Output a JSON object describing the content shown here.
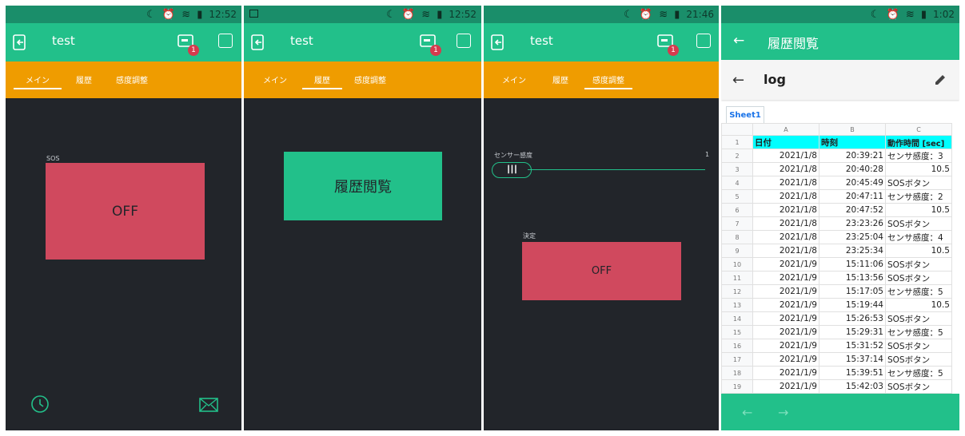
{
  "colors": {
    "primary": "#22c08a",
    "accent": "#ef9c00",
    "danger": "#d0495e",
    "background": "#22252a",
    "header_fill": "#00ffff"
  },
  "app": {
    "title": "test",
    "badge_count": "1",
    "tabs": [
      "メイン",
      "履歴",
      "感度調整"
    ]
  },
  "screens": [
    {
      "status_time": "12:52",
      "active_tab": 0
    },
    {
      "status_time": "12:52",
      "active_tab": 1
    },
    {
      "status_time": "21:46",
      "active_tab": 2
    },
    {
      "status_time": "1:02"
    }
  ],
  "main": {
    "sos_label": "SOS",
    "sos_button": "OFF",
    "icons": [
      "clock-icon",
      "mail-icon"
    ]
  },
  "history": {
    "view_button": "履歴閲覧"
  },
  "sensitivity": {
    "slider_label": "センサー感度",
    "slider_value": "1",
    "confirm_label": "決定",
    "confirm_button": "OFF"
  },
  "sheet": {
    "page_title": "履歴閲覧",
    "file_name": "log",
    "sheet_tab": "Sheet1",
    "columns": [
      "A",
      "B",
      "C"
    ],
    "header": [
      "日付",
      "時刻",
      "動作時間 [sec]"
    ],
    "rows": [
      [
        "2021/1/8",
        "20:39:21",
        "センサ感度：3"
      ],
      [
        "2021/1/8",
        "20:40:28",
        "10.5"
      ],
      [
        "2021/1/8",
        "20:45:49",
        "SOSボタン"
      ],
      [
        "2021/1/8",
        "20:47:11",
        "センサ感度：2"
      ],
      [
        "2021/1/8",
        "20:47:52",
        "10.5"
      ],
      [
        "2021/1/8",
        "23:23:26",
        "SOSボタン"
      ],
      [
        "2021/1/8",
        "23:25:04",
        "センサ感度：4"
      ],
      [
        "2021/1/8",
        "23:25:34",
        "10.5"
      ],
      [
        "2021/1/9",
        "15:11:06",
        "SOSボタン"
      ],
      [
        "2021/1/9",
        "15:13:56",
        "SOSボタン"
      ],
      [
        "2021/1/9",
        "15:17:05",
        "センサ感度：5"
      ],
      [
        "2021/1/9",
        "15:19:44",
        "10.5"
      ],
      [
        "2021/1/9",
        "15:26:53",
        "SOSボタン"
      ],
      [
        "2021/1/9",
        "15:29:31",
        "センサ感度：5"
      ],
      [
        "2021/1/9",
        "15:31:52",
        "SOSボタン"
      ],
      [
        "2021/1/9",
        "15:37:14",
        "SOSボタン"
      ],
      [
        "2021/1/9",
        "15:39:51",
        "センサ感度：5"
      ],
      [
        "2021/1/9",
        "15:42:03",
        "SOSボタン"
      ]
    ]
  }
}
